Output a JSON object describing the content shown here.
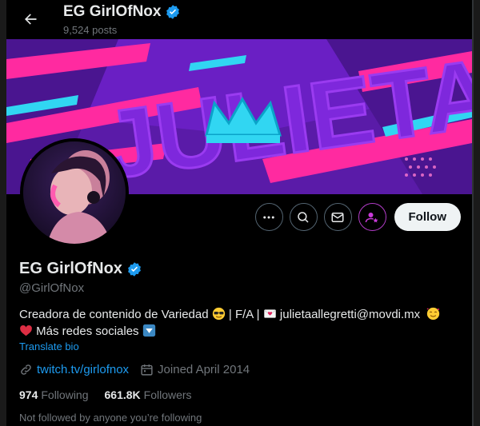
{
  "header": {
    "title": "EG GirlOfNox",
    "posts_count": "9,524 posts"
  },
  "banner": {
    "text": "JULIETA"
  },
  "actions": {
    "follow_label": "Follow"
  },
  "profile": {
    "display_name": "EG GirlOfNox",
    "handle": "@GirlOfNox",
    "bio_part1": "Creadora de contenido de Variedad",
    "bio_part2": "| F/A |",
    "bio_email": "julietaallegretti@movdi.mx",
    "bio_line2": "Más redes sociales",
    "translate_label": "Translate bio",
    "website": "twitch.tv/girlofnox",
    "joined": "Joined April 2014",
    "following_count": "974",
    "following_label": "Following",
    "followers_count": "661.8K",
    "followers_label": "Followers",
    "not_followed": "Not followed by anyone you’re following"
  },
  "colors": {
    "verified": "#1d9bf0",
    "link": "#1d9bf0",
    "banner_pink": "#ff2aa0",
    "banner_purple": "#7a22d6",
    "banner_cyan": "#31d6f2"
  }
}
